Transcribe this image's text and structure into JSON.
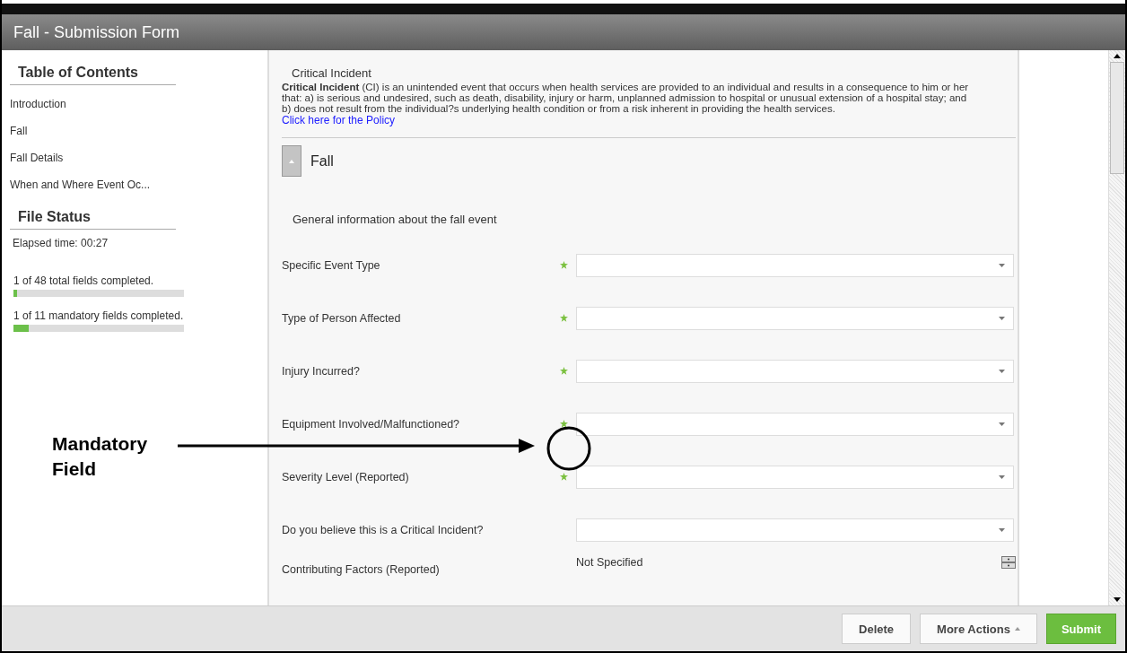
{
  "window": {
    "title": "Fall - Submission Form"
  },
  "sidebar": {
    "toc_title": "Table of Contents",
    "items": [
      {
        "label": "Introduction"
      },
      {
        "label": "Fall"
      },
      {
        "label": "Fall Details"
      },
      {
        "label": "When and Where Event Oc..."
      }
    ],
    "status_title": "File Status",
    "elapsed": "Elapsed time: 00:27",
    "progress": [
      {
        "label": "1 of 48 total fields completed.",
        "level": 0.02
      },
      {
        "label": "1 of 11 mandatory fields completed.",
        "level": 0.09
      }
    ]
  },
  "intro": {
    "heading": "Critical Incident",
    "text": "**Critical Incident** (CI) is an unintended event that occurs when health services are provided to an individual and results in a consequence to him or her that: a) is serious and undesired, such as death, disability, injury or harm, unplanned admission to hospital or unusual extension of a hospital stay; and b) does not result from the individual?s underlying health condition or from a risk inherent in providing the health services.",
    "link": "Click here for the Policy"
  },
  "section": {
    "title": "Fall",
    "expanded": true,
    "subtitle": "General information about the fall event"
  },
  "fields": [
    {
      "label": "Specific Event Type",
      "kind": "select",
      "mandatory": true
    },
    {
      "label": "Type of Person Affected",
      "kind": "select",
      "mandatory": true
    },
    {
      "label": "Injury Incurred?",
      "kind": "select",
      "mandatory": true
    },
    {
      "label": "Equipment Involved/Malfunctioned?",
      "kind": "select",
      "mandatory": true
    },
    {
      "label": "Severity Level (Reported)",
      "kind": "select",
      "mandatory": true
    },
    {
      "label": "Do you believe this is a Critical Incident?",
      "kind": "select",
      "mandatory": false
    },
    {
      "label": "Contributing Factors (Reported)",
      "kind": "multi",
      "mandatory": false,
      "value": "Not Specified"
    }
  ],
  "footer": {
    "buttons": [
      {
        "label": "Delete",
        "kind": "plain"
      },
      {
        "label": "More Actions",
        "kind": "menu"
      },
      {
        "label": "Submit",
        "kind": "primary"
      }
    ]
  },
  "annotation": {
    "text": "Mandatory Field"
  }
}
